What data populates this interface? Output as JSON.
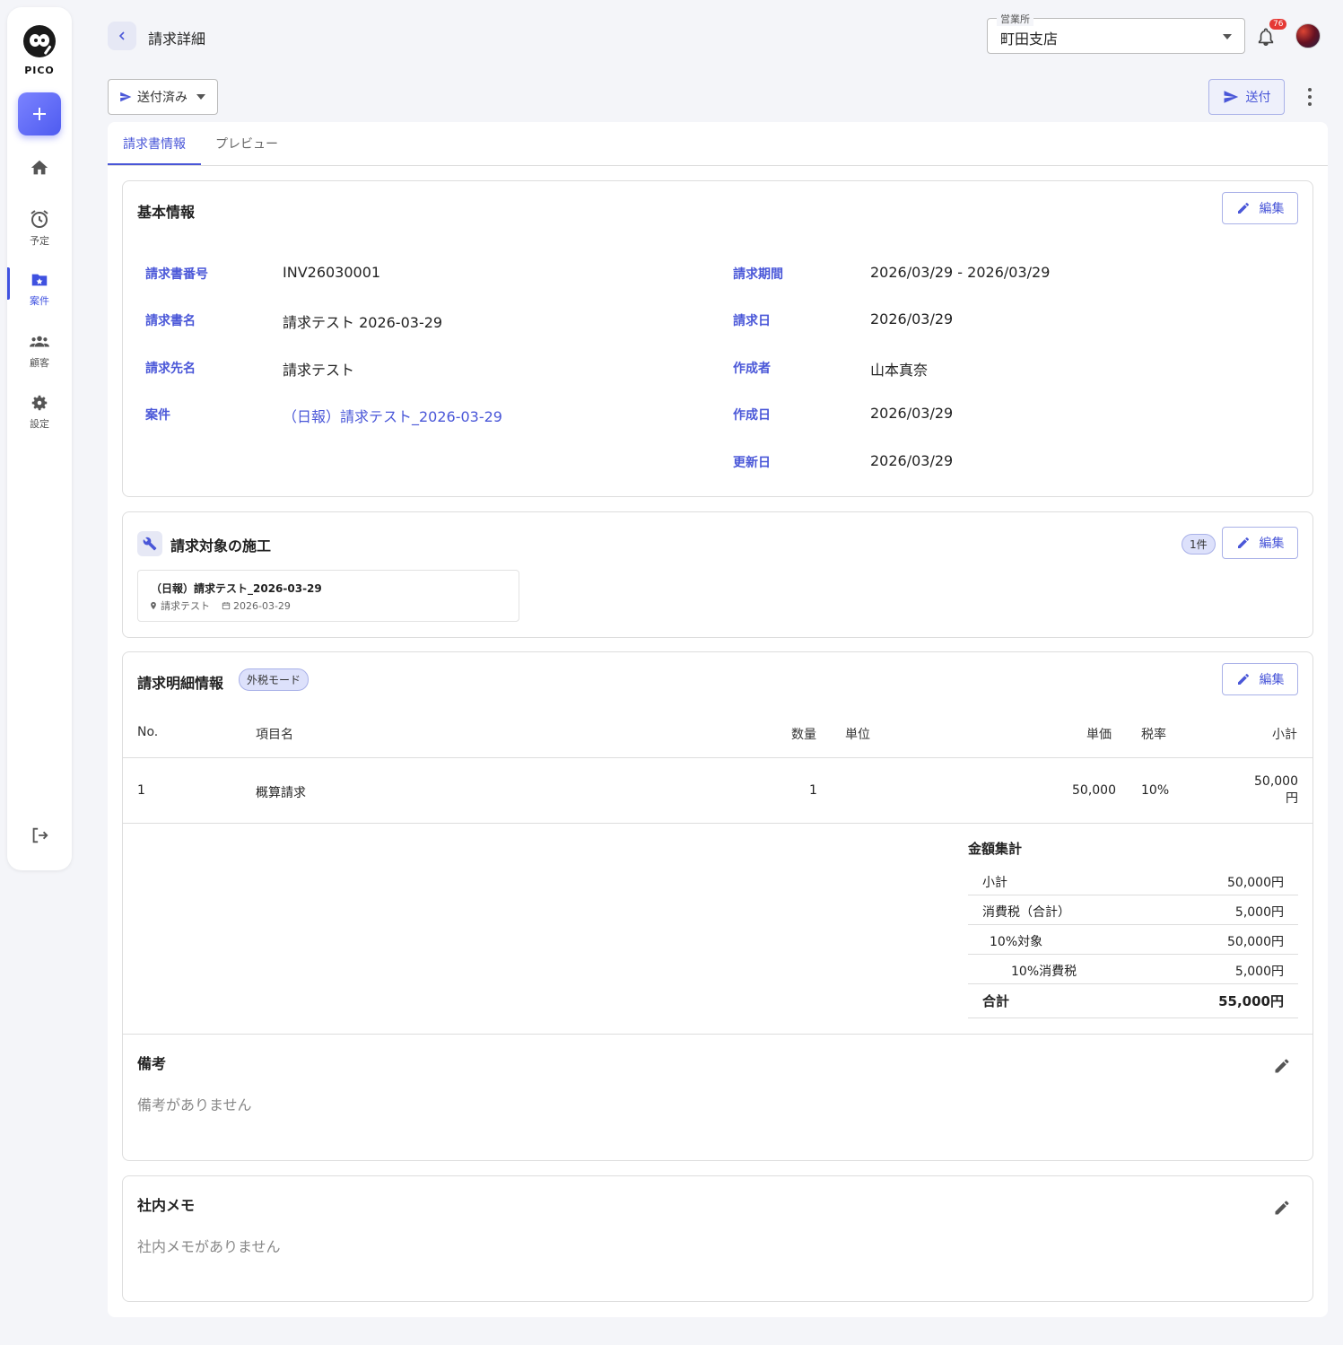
{
  "sidebar": {
    "logo_text": "PICO",
    "items": [
      {
        "label": ""
      },
      {
        "label": "予定"
      },
      {
        "label": "案件"
      },
      {
        "label": "顧客"
      },
      {
        "label": "設定"
      }
    ]
  },
  "header": {
    "title": "請求詳細",
    "office_legend": "営業所",
    "office_value": "町田支店",
    "notification_count": "76"
  },
  "toolbar": {
    "status_label": "送付済み",
    "send_label": "送付"
  },
  "tabs": [
    {
      "label": "請求書情報"
    },
    {
      "label": "プレビュー"
    }
  ],
  "basic": {
    "title": "基本情報",
    "edit_label": "編集",
    "left": [
      {
        "label": "請求書番号",
        "value": "INV26030001"
      },
      {
        "label": "請求書名",
        "value": "請求テスト 2026-03-29"
      },
      {
        "label": "請求先名",
        "value": "請求テスト"
      },
      {
        "label": "案件",
        "value": "（日報）請求テスト_2026-03-29"
      }
    ],
    "right": [
      {
        "label": "請求期間",
        "value": "2026/03/29 - 2026/03/29"
      },
      {
        "label": "請求日",
        "value": "2026/03/29"
      },
      {
        "label": "作成者",
        "value": "山本真奈"
      },
      {
        "label": "作成日",
        "value": "2026/03/29"
      },
      {
        "label": "更新日",
        "value": "2026/03/29"
      }
    ]
  },
  "construction": {
    "title": "請求対象の施工",
    "count": "1件",
    "edit_label": "編集",
    "item_title": "（日報）請求テスト_2026-03-29",
    "item_location": "請求テスト",
    "item_date": "2026-03-29"
  },
  "details": {
    "title": "請求明細情報",
    "mode": "外税モード",
    "edit_label": "編集",
    "headers": {
      "no": "No.",
      "name": "項目名",
      "qty": "数量",
      "unit": "単位",
      "price": "単価",
      "tax": "税率",
      "subtotal": "小計"
    },
    "rows": [
      {
        "no": "1",
        "name": "概算請求",
        "qty": "1",
        "unit": "",
        "price": "50,000",
        "tax": "10%",
        "subtotal_num": "50,000",
        "subtotal_unit": "円"
      }
    ],
    "summary": {
      "title": "金額集計",
      "rows": [
        {
          "label": "小計",
          "value": "50,000円"
        },
        {
          "label": "消費税（合計）",
          "value": "5,000円"
        },
        {
          "label": "10%対象",
          "value": "50,000円"
        },
        {
          "label": "10%消費税",
          "value": "5,000円"
        }
      ],
      "total_label": "合計",
      "total_value": "55,000円"
    }
  },
  "notes": {
    "title": "備考",
    "empty": "備考がありません"
  },
  "memo": {
    "title": "社内メモ",
    "empty": "社内メモがありません"
  },
  "colors": {
    "accent": "#4a57d8",
    "badge": "#e53935"
  }
}
